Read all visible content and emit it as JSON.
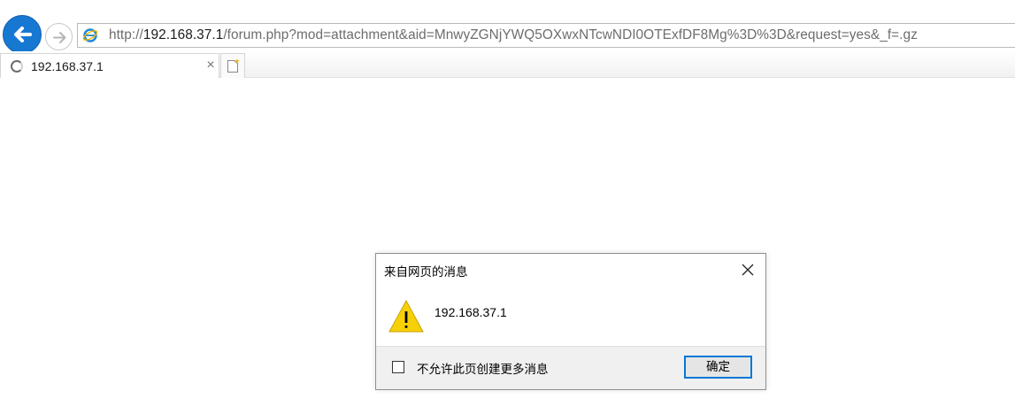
{
  "browser": {
    "address_bar": {
      "url_prefix": "http://",
      "url_host": "192.168.37.1",
      "url_path": "/forum.php?mod=attachment&aid=MnwyZGNjYWQ5OXwxNTcwNDI0OTExfDF8Mg%3D%3D&request=yes&_f=.gz"
    },
    "tab": {
      "title": "192.168.37.1",
      "close_glyph": "×"
    },
    "icons": {
      "back": "back-arrow-icon",
      "forward": "forward-arrow-icon",
      "site": "ie-logo-icon",
      "loading": "loading-spinner-icon",
      "new_tab": "new-tab-icon"
    },
    "colors": {
      "back_button": "#1778d2",
      "accent": "#0078d7"
    }
  },
  "dialog": {
    "title": "来自网页的消息",
    "message": "192.168.37.1",
    "checkbox_label": "不允许此页创建更多消息",
    "checkbox_checked": false,
    "ok_label": "确定",
    "icons": {
      "warning": "warning-icon",
      "close": "close-icon"
    },
    "colors": {
      "warning_fill": "#f7d108"
    }
  }
}
